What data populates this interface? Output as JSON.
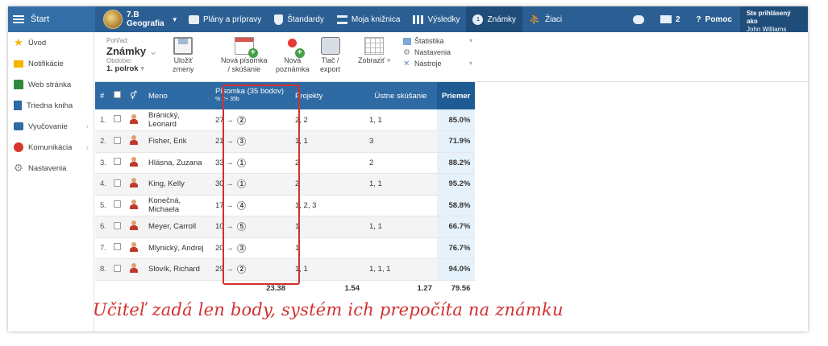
{
  "topbar": {
    "start_label": "Štart",
    "class_name": "7.B",
    "subject": "Geografia",
    "nav": [
      {
        "label": "Plány a prípravy",
        "icon": "book-icon"
      },
      {
        "label": "Štandardy",
        "icon": "shield-icon"
      },
      {
        "label": "Moja knižnica",
        "icon": "library-icon"
      },
      {
        "label": "Výsledky",
        "icon": "bar-chart-icon"
      },
      {
        "label": "Známky",
        "icon": "grade-icon"
      },
      {
        "label": "Žiaci",
        "icon": "students-icon"
      }
    ],
    "mail_count": "2",
    "help_label": "Pomoc",
    "user_status": "Ste prihlásený ako",
    "user_name": "John Williams"
  },
  "sidebar": {
    "items": [
      {
        "label": "Úvod",
        "icon": "star-icon"
      },
      {
        "label": "Notifikácie",
        "icon": "envelope-icon"
      },
      {
        "label": "Web stránka",
        "icon": "home-icon"
      },
      {
        "label": "Triedna kniha",
        "icon": "book-icon"
      },
      {
        "label": "Vyučovanie",
        "icon": "briefcase-icon"
      },
      {
        "label": "Komunikácia",
        "icon": "chat-icon"
      },
      {
        "label": "Nastavenia",
        "icon": "gear-icon"
      }
    ]
  },
  "ribbon": {
    "view_label": "Pohľad:",
    "view_value": "Známky",
    "period_label": "Obdobie:",
    "period_value": "1. polrok",
    "save_line1": "Uložiť",
    "save_line2": "zmeny",
    "new_exam_line1": "Nová písomka",
    "new_exam_line2": "/ skúšanie",
    "new_note_line1": "Nová",
    "new_note_line2": "poznámka",
    "print_line1": "Tlač /",
    "print_line2": "export",
    "show_label": "Zobraziť",
    "stats_label": "Štatistika",
    "settings_label": "Nastavenia",
    "tools_label": "Nástroje"
  },
  "table": {
    "headers": {
      "num": "#",
      "name": "Meno",
      "exam": "Písomka (35 bodov)",
      "exam_sub": "%  2+  35b",
      "projects": "Projekty",
      "oral": "Ústne skúšanie",
      "avg": "Priemer"
    },
    "arrow": "→",
    "rows": [
      {
        "num": "1.",
        "name": "Bránický, Leonard",
        "points": "27",
        "grade": "2",
        "projects": "2, 2",
        "oral": "1, 1",
        "avg": "85.0%"
      },
      {
        "num": "2.",
        "name": "Fisher, Erik",
        "points": "21",
        "grade": "3",
        "projects": "1, 1",
        "oral": "3",
        "avg": "71.9%"
      },
      {
        "num": "3.",
        "name": "Hlásna, Zuzana",
        "points": "33",
        "grade": "1",
        "projects": "2",
        "oral": "2",
        "avg": "88.2%"
      },
      {
        "num": "4.",
        "name": "King, Kelly",
        "points": "30",
        "grade": "1",
        "projects": "2",
        "oral": "1, 1",
        "avg": "95.2%"
      },
      {
        "num": "5.",
        "name": "Konečná, Michaela",
        "points": "17",
        "grade": "4",
        "projects": "1, 2, 3",
        "oral": "",
        "avg": "58.8%"
      },
      {
        "num": "6.",
        "name": "Meyer, Carroll",
        "points": "10",
        "grade": "5",
        "projects": "1",
        "oral": "1, 1",
        "avg": "66.7%"
      },
      {
        "num": "7.",
        "name": "Mlynický, Andrej",
        "points": "20",
        "grade": "3",
        "projects": "1",
        "oral": "",
        "avg": "76.7%"
      },
      {
        "num": "8.",
        "name": "Slovík, Richard",
        "points": "29",
        "grade": "2",
        "projects": "1, 1",
        "oral": "1, 1, 1",
        "avg": "94.0%"
      }
    ],
    "footer": {
      "exam": "23.38",
      "projects": "1.54",
      "oral": "1.27",
      "avg": "79.56"
    }
  },
  "caption": "Učiteľ zadá len body, systém ich prepočíta na známku",
  "colors": {
    "topbar": "#2b5f93",
    "header": "#2e6aa3",
    "highlight": "#d32f2f",
    "avg_bg": "#e6f2fb"
  }
}
